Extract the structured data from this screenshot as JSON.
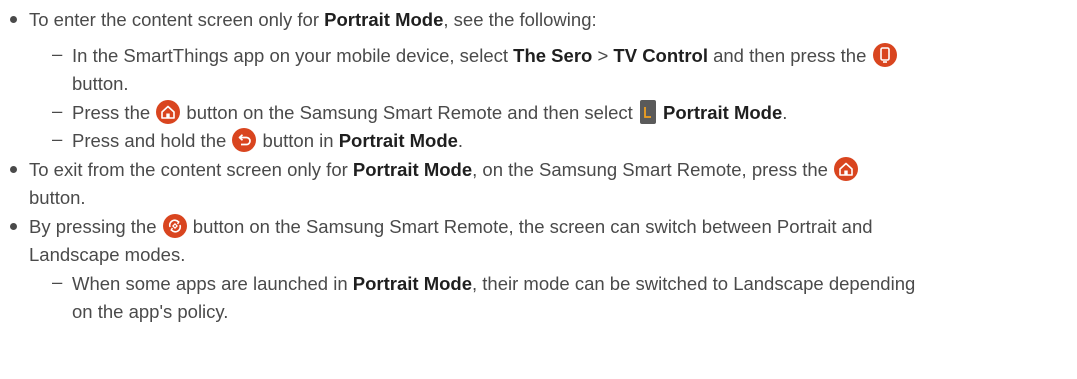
{
  "bullets": [
    {
      "pre": "To enter the content screen only for ",
      "bold": "Portrait Mode",
      "post": ", see the following:"
    },
    {
      "pre": "To exit from the content screen only for ",
      "bold": "Portrait Mode",
      "mid": ", on the Samsung Smart Remote, press the ",
      "cont": "button."
    },
    {
      "pre": "By pressing the ",
      "mid": " button on the Samsung Smart Remote, the screen can switch between Portrait and",
      "cont": "Landscape modes."
    }
  ],
  "subs": [
    {
      "pre": "In the SmartThings app on your mobile device, select ",
      "bold1": "The Sero",
      "sep": " > ",
      "bold2": "TV Control",
      "post": " and then press the ",
      "cont": "button."
    },
    {
      "pre": "Press the ",
      "mid": " button on the Samsung Smart Remote and then select ",
      "bold": "Portrait Mode",
      "post": "."
    },
    {
      "pre": "Press and hold the ",
      "mid": " button in ",
      "bold": "Portrait Mode",
      "post": "."
    },
    {
      "pre": "When some apps are launched in ",
      "bold": "Portrait Mode",
      "mid": ", their mode can be switched to Landscape depending",
      "cont": "on the app's policy."
    }
  ],
  "dash_char": "–",
  "colors": {
    "icon": "#d9451f",
    "text": "#4a4a4a",
    "bold": "#1f1f1f"
  },
  "icons": [
    "portrait-toggle-icon",
    "home-icon",
    "portrait-mode-app-icon",
    "back-icon",
    "rotate-icon"
  ]
}
